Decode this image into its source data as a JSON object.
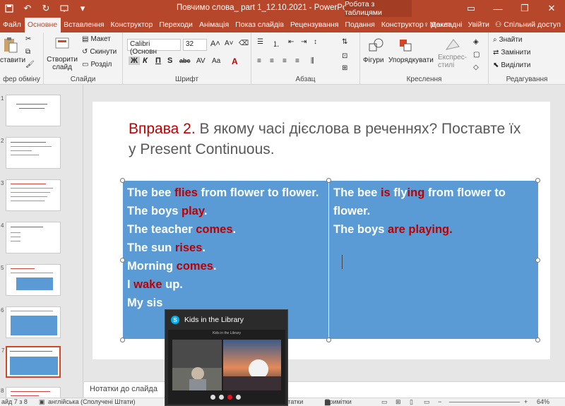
{
  "app": {
    "title": "Повчимо слова_ part 1_12.10.2021 - PowerPoint",
    "context_tab_title": "Робота з таблицями",
    "accent": "#b7472a"
  },
  "tabs": [
    {
      "label": "Файл"
    },
    {
      "label": "Основне",
      "active": true
    },
    {
      "label": "Вставлення"
    },
    {
      "label": "Конструктор"
    },
    {
      "label": "Переходи"
    },
    {
      "label": "Анімація"
    },
    {
      "label": "Показ слайдів"
    },
    {
      "label": "Рецензування"
    },
    {
      "label": "Подання"
    },
    {
      "label": "Конструктор"
    },
    {
      "label": "Макет"
    }
  ],
  "tabs_right": {
    "tell_me": "Докладні",
    "sign_in": "Увійти",
    "share": "Спільний доступ"
  },
  "ribbon": {
    "paste": "ставити",
    "clipboard": "фер обміну",
    "new_slide": "Створити слайд",
    "layout": "Макет",
    "reset": "Скинути",
    "section": "Розділ",
    "slides": "Слайди",
    "font_name": "Calibri (Основн",
    "font_size": "32",
    "font": "Шрифт",
    "paragraph": "Абзац",
    "shapes": "Фігури",
    "arrange": "Упорядкувати",
    "quick_styles": "Експрес-стилі",
    "drawing": "Креслення",
    "find": "Знайти",
    "replace": "Замінити",
    "select": "Виділити",
    "editing": "Редагування",
    "bold": "Ж",
    "italic": "К",
    "underline": "П",
    "strike": "S",
    "shadow": "abc"
  },
  "slide": {
    "heading_red": "Вправа 2.",
    "heading_rest": " В якому часі дієслова в реченнях? Поставте їх у Present Continuous.",
    "col1": [
      [
        {
          "t": "The bee "
        },
        {
          "t": "flies",
          "r": true
        },
        {
          "t": " from flower to flower."
        }
      ],
      [
        {
          "t": "The boys "
        },
        {
          "t": "play",
          "r": true
        },
        {
          "t": "."
        }
      ],
      [
        {
          "t": "The teacher "
        },
        {
          "t": "comes",
          "r": true
        },
        {
          "t": "."
        }
      ],
      [
        {
          "t": "The sun "
        },
        {
          "t": "rises",
          "r": true
        },
        {
          "t": "."
        }
      ],
      [
        {
          "t": "Morning "
        },
        {
          "t": "comes",
          "r": true
        },
        {
          "t": "."
        }
      ],
      [
        {
          "t": "I "
        },
        {
          "t": "wake",
          "r": true
        },
        {
          "t": " up."
        }
      ],
      [
        {
          "t": "My sis"
        }
      ]
    ],
    "col2": [
      [
        {
          "t": "The bee "
        },
        {
          "t": "is",
          "r": true
        },
        {
          "t": " fly"
        },
        {
          "t": "ing",
          "r": true
        },
        {
          "t": " from flower to flower."
        }
      ],
      [
        {
          "t": "The boys "
        },
        {
          "t": "are playing.",
          "r": true
        }
      ]
    ]
  },
  "thumbnails": [
    "1",
    "2",
    "3",
    "4",
    "5",
    "6",
    "7",
    "8"
  ],
  "notes_placeholder": "Нотатки до слайда",
  "status": {
    "slide_of": "айд 7 з 8",
    "language": "англійська (Сполучені Штати)",
    "notes": "Нотатки",
    "comments": "Примітки",
    "zoom": "64%"
  },
  "skype": {
    "title": "Kids in the Library",
    "inner_title": "Kids in the Library"
  }
}
